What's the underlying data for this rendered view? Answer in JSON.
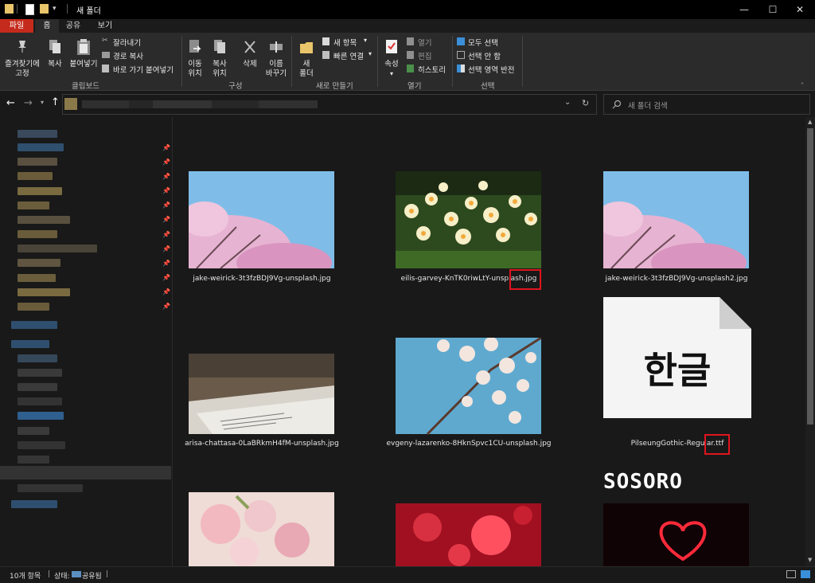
{
  "window": {
    "title": "새 폴더",
    "controls": {
      "minimize": "—",
      "maximize": "☐",
      "close": "✕"
    }
  },
  "tabs": [
    "파일",
    "홈",
    "공유",
    "보기"
  ],
  "ribbon": {
    "clipboard": {
      "pin_line1": "즐겨찾기에",
      "pin_line2": "고정",
      "copy": "복사",
      "paste": "붙여넣기",
      "cut": "잘라내기",
      "copy_path": "경로 복사",
      "paste_shortcut": "바로 가기 붙여넣기",
      "group_label": "클립보드"
    },
    "organize": {
      "move_to_1": "이동",
      "move_to_2": "위치",
      "copy_to_1": "복사",
      "copy_to_2": "위치",
      "delete": "삭제",
      "rename_1": "이름",
      "rename_2": "바꾸기",
      "group_label": "구성"
    },
    "new": {
      "new_folder_1": "새",
      "new_folder_2": "폴더",
      "new_item": "새 항목",
      "easy_access": "빠른 연결",
      "group_label": "새로 만들기"
    },
    "open": {
      "properties": "속성",
      "open": "열기",
      "edit": "편집",
      "history": "히스토리",
      "group_label": "열기"
    },
    "select": {
      "select_all": "모두 선택",
      "select_none": "선택 안 함",
      "invert": "선택 영역 반전",
      "group_label": "선택"
    }
  },
  "search": {
    "placeholder": "새 폴더 검색"
  },
  "files": [
    {
      "name": "jake-weirick-3t3fzBDJ9Vg-unsplash.jpg"
    },
    {
      "name": "eilis-garvey-KnTK0riwLtY-unsplash.jpg"
    },
    {
      "name": "jake-weirick-3t3fzBDJ9Vg-unsplash2.jpg"
    },
    {
      "name": "arisa-chattasa-0LaBRkmH4fM-unsplash.jpg"
    },
    {
      "name": "evgeny-lazarenko-8HknSpvc1CU-unsplash.jpg"
    },
    {
      "name": "PilseungGothic-Regular.ttf",
      "preview_text": "한글"
    }
  ],
  "watermark": "SOSORO",
  "status": {
    "count": "10개 항목",
    "state_label": "상태:",
    "state_value": "공유됨"
  },
  "colors": {
    "accent_file_tab": "#c42b1c",
    "highlight_box": "#e0141e",
    "background": "#191919"
  }
}
